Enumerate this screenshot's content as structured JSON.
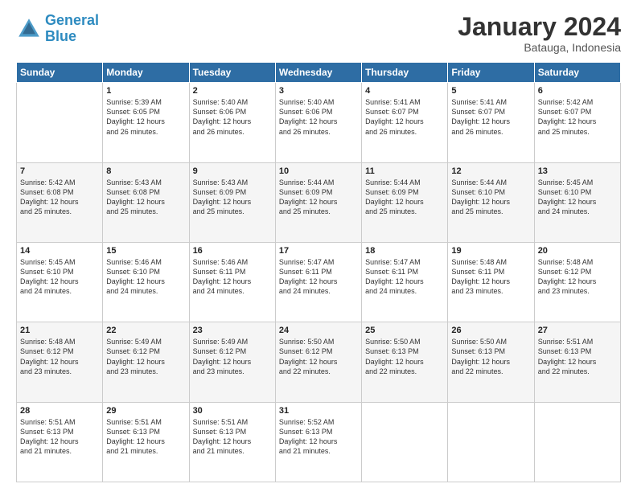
{
  "logo": {
    "line1": "General",
    "line2": "Blue"
  },
  "title": "January 2024",
  "subtitle": "Batauga, Indonesia",
  "days_of_week": [
    "Sunday",
    "Monday",
    "Tuesday",
    "Wednesday",
    "Thursday",
    "Friday",
    "Saturday"
  ],
  "weeks": [
    [
      {
        "day": "",
        "info": ""
      },
      {
        "day": "1",
        "info": "Sunrise: 5:39 AM\nSunset: 6:05 PM\nDaylight: 12 hours\nand 26 minutes."
      },
      {
        "day": "2",
        "info": "Sunrise: 5:40 AM\nSunset: 6:06 PM\nDaylight: 12 hours\nand 26 minutes."
      },
      {
        "day": "3",
        "info": "Sunrise: 5:40 AM\nSunset: 6:06 PM\nDaylight: 12 hours\nand 26 minutes."
      },
      {
        "day": "4",
        "info": "Sunrise: 5:41 AM\nSunset: 6:07 PM\nDaylight: 12 hours\nand 26 minutes."
      },
      {
        "day": "5",
        "info": "Sunrise: 5:41 AM\nSunset: 6:07 PM\nDaylight: 12 hours\nand 26 minutes."
      },
      {
        "day": "6",
        "info": "Sunrise: 5:42 AM\nSunset: 6:07 PM\nDaylight: 12 hours\nand 25 minutes."
      }
    ],
    [
      {
        "day": "7",
        "info": "Sunrise: 5:42 AM\nSunset: 6:08 PM\nDaylight: 12 hours\nand 25 minutes."
      },
      {
        "day": "8",
        "info": "Sunrise: 5:43 AM\nSunset: 6:08 PM\nDaylight: 12 hours\nand 25 minutes."
      },
      {
        "day": "9",
        "info": "Sunrise: 5:43 AM\nSunset: 6:09 PM\nDaylight: 12 hours\nand 25 minutes."
      },
      {
        "day": "10",
        "info": "Sunrise: 5:44 AM\nSunset: 6:09 PM\nDaylight: 12 hours\nand 25 minutes."
      },
      {
        "day": "11",
        "info": "Sunrise: 5:44 AM\nSunset: 6:09 PM\nDaylight: 12 hours\nand 25 minutes."
      },
      {
        "day": "12",
        "info": "Sunrise: 5:44 AM\nSunset: 6:10 PM\nDaylight: 12 hours\nand 25 minutes."
      },
      {
        "day": "13",
        "info": "Sunrise: 5:45 AM\nSunset: 6:10 PM\nDaylight: 12 hours\nand 24 minutes."
      }
    ],
    [
      {
        "day": "14",
        "info": "Sunrise: 5:45 AM\nSunset: 6:10 PM\nDaylight: 12 hours\nand 24 minutes."
      },
      {
        "day": "15",
        "info": "Sunrise: 5:46 AM\nSunset: 6:10 PM\nDaylight: 12 hours\nand 24 minutes."
      },
      {
        "day": "16",
        "info": "Sunrise: 5:46 AM\nSunset: 6:11 PM\nDaylight: 12 hours\nand 24 minutes."
      },
      {
        "day": "17",
        "info": "Sunrise: 5:47 AM\nSunset: 6:11 PM\nDaylight: 12 hours\nand 24 minutes."
      },
      {
        "day": "18",
        "info": "Sunrise: 5:47 AM\nSunset: 6:11 PM\nDaylight: 12 hours\nand 24 minutes."
      },
      {
        "day": "19",
        "info": "Sunrise: 5:48 AM\nSunset: 6:11 PM\nDaylight: 12 hours\nand 23 minutes."
      },
      {
        "day": "20",
        "info": "Sunrise: 5:48 AM\nSunset: 6:12 PM\nDaylight: 12 hours\nand 23 minutes."
      }
    ],
    [
      {
        "day": "21",
        "info": "Sunrise: 5:48 AM\nSunset: 6:12 PM\nDaylight: 12 hours\nand 23 minutes."
      },
      {
        "day": "22",
        "info": "Sunrise: 5:49 AM\nSunset: 6:12 PM\nDaylight: 12 hours\nand 23 minutes."
      },
      {
        "day": "23",
        "info": "Sunrise: 5:49 AM\nSunset: 6:12 PM\nDaylight: 12 hours\nand 23 minutes."
      },
      {
        "day": "24",
        "info": "Sunrise: 5:50 AM\nSunset: 6:12 PM\nDaylight: 12 hours\nand 22 minutes."
      },
      {
        "day": "25",
        "info": "Sunrise: 5:50 AM\nSunset: 6:13 PM\nDaylight: 12 hours\nand 22 minutes."
      },
      {
        "day": "26",
        "info": "Sunrise: 5:50 AM\nSunset: 6:13 PM\nDaylight: 12 hours\nand 22 minutes."
      },
      {
        "day": "27",
        "info": "Sunrise: 5:51 AM\nSunset: 6:13 PM\nDaylight: 12 hours\nand 22 minutes."
      }
    ],
    [
      {
        "day": "28",
        "info": "Sunrise: 5:51 AM\nSunset: 6:13 PM\nDaylight: 12 hours\nand 21 minutes."
      },
      {
        "day": "29",
        "info": "Sunrise: 5:51 AM\nSunset: 6:13 PM\nDaylight: 12 hours\nand 21 minutes."
      },
      {
        "day": "30",
        "info": "Sunrise: 5:51 AM\nSunset: 6:13 PM\nDaylight: 12 hours\nand 21 minutes."
      },
      {
        "day": "31",
        "info": "Sunrise: 5:52 AM\nSunset: 6:13 PM\nDaylight: 12 hours\nand 21 minutes."
      },
      {
        "day": "",
        "info": ""
      },
      {
        "day": "",
        "info": ""
      },
      {
        "day": "",
        "info": ""
      }
    ]
  ]
}
